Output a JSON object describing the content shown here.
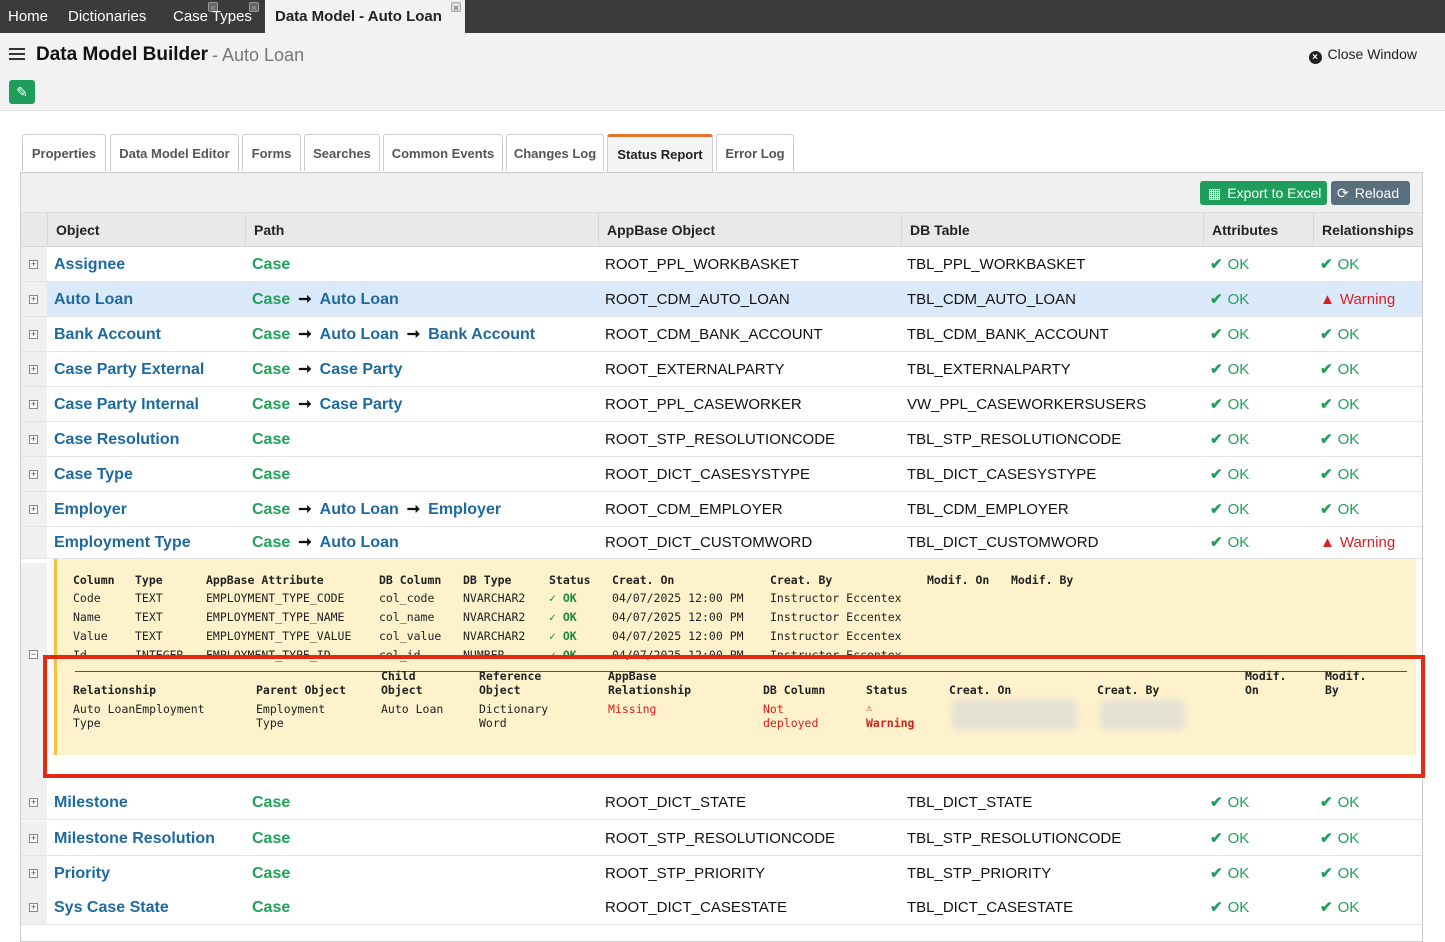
{
  "top_tabs": [
    {
      "label": "Home"
    },
    {
      "label": "Dictionaries",
      "close": "×"
    },
    {
      "label": "Case Types",
      "close": "×"
    },
    {
      "label": "Data Model - Auto Loan",
      "close": "×"
    }
  ],
  "header": {
    "title": "Data Model Builder",
    "subtitle": "- Auto Loan",
    "close_label": "Close Window"
  },
  "sub_tabs": [
    {
      "label": "Properties"
    },
    {
      "label": "Data Model Editor"
    },
    {
      "label": "Forms"
    },
    {
      "label": "Searches"
    },
    {
      "label": "Common Events"
    },
    {
      "label": "Changes Log"
    },
    {
      "label": "Status Report"
    },
    {
      "label": "Error Log"
    }
  ],
  "toolbar": {
    "export_label": "Export to Excel",
    "reload_label": "Reload"
  },
  "columns": {
    "object": "Object",
    "path": "Path",
    "appbase": "AppBase Object",
    "db": "DB Table",
    "attributes": "Attributes",
    "relationships": "Relationships"
  },
  "rows": [
    {
      "object": "Assignee",
      "path": [
        "Case"
      ],
      "appbase": "ROOT_PPL_WORKBASKET",
      "db": "TBL_PPL_WORKBASKET",
      "attributes": "OK",
      "relationships": "OK"
    },
    {
      "object": "Auto Loan",
      "path": [
        "Case",
        "Auto Loan"
      ],
      "appbase": "ROOT_CDM_AUTO_LOAN",
      "db": "TBL_CDM_AUTO_LOAN",
      "attributes": "OK",
      "relationships": "Warning"
    },
    {
      "object": "Bank Account",
      "path": [
        "Case",
        "Auto Loan",
        "Bank Account"
      ],
      "appbase": "ROOT_CDM_BANK_ACCOUNT",
      "db": "TBL_CDM_BANK_ACCOUNT",
      "attributes": "OK",
      "relationships": "OK"
    },
    {
      "object": "Case Party External",
      "path": [
        "Case",
        "Case Party"
      ],
      "appbase": "ROOT_EXTERNALPARTY",
      "db": "TBL_EXTERNALPARTY",
      "attributes": "OK",
      "relationships": "OK"
    },
    {
      "object": "Case Party Internal",
      "path": [
        "Case",
        "Case Party"
      ],
      "appbase": "ROOT_PPL_CASEWORKER",
      "db": "VW_PPL_CASEWORKERSUSERS",
      "attributes": "OK",
      "relationships": "OK"
    },
    {
      "object": "Case Resolution",
      "path": [
        "Case"
      ],
      "appbase": "ROOT_STP_RESOLUTIONCODE",
      "db": "TBL_STP_RESOLUTIONCODE",
      "attributes": "OK",
      "relationships": "OK"
    },
    {
      "object": "Case Type",
      "path": [
        "Case"
      ],
      "appbase": "ROOT_DICT_CASESYSTYPE",
      "db": "TBL_DICT_CASESYSTYPE",
      "attributes": "OK",
      "relationships": "OK"
    },
    {
      "object": "Employer",
      "path": [
        "Case",
        "Auto Loan",
        "Employer"
      ],
      "appbase": "ROOT_CDM_EMPLOYER",
      "db": "TBL_CDM_EMPLOYER",
      "attributes": "OK",
      "relationships": "OK"
    },
    {
      "object": "Employment Type",
      "path": [
        "Case",
        "Auto Loan"
      ],
      "appbase": "ROOT_DICT_CUSTOMWORD",
      "db": "TBL_DICT_CUSTOMWORD",
      "attributes": "OK",
      "relationships": "Warning"
    },
    {
      "object": "Milestone",
      "path": [
        "Case"
      ],
      "appbase": "ROOT_DICT_STATE",
      "db": "TBL_DICT_STATE",
      "attributes": "OK",
      "relationships": "OK"
    },
    {
      "object": "Milestone Resolution",
      "path": [
        "Case"
      ],
      "appbase": "ROOT_STP_RESOLUTIONCODE",
      "db": "TBL_STP_RESOLUTIONCODE",
      "attributes": "OK",
      "relationships": "OK"
    },
    {
      "object": "Priority",
      "path": [
        "Case"
      ],
      "appbase": "ROOT_STP_PRIORITY",
      "db": "TBL_STP_PRIORITY",
      "attributes": "OK",
      "relationships": "OK"
    },
    {
      "object": "Sys Case State",
      "path": [
        "Case"
      ],
      "appbase": "ROOT_DICT_CASESTATE",
      "db": "TBL_DICT_CASESTATE",
      "attributes": "OK",
      "relationships": "OK"
    }
  ],
  "attr_detail": {
    "headers": [
      "Column",
      "Type",
      "AppBase Attribute",
      "DB Column",
      "DB Type",
      "Status",
      "Creat. On",
      "Creat. By",
      "Modif. On",
      "Modif. By"
    ],
    "rows": [
      [
        "Code",
        "TEXT",
        "EMPLOYMENT_TYPE_CODE",
        "col_code",
        "NVARCHAR2",
        "✓ OK",
        "04/07/2025 12:00 PM",
        "Instructor Eccentex"
      ],
      [
        "Name",
        "TEXT",
        "EMPLOYMENT_TYPE_NAME",
        "col_name",
        "NVARCHAR2",
        "✓ OK",
        "04/07/2025 12:00 PM",
        "Instructor Eccentex"
      ],
      [
        "Value",
        "TEXT",
        "EMPLOYMENT_TYPE_VALUE",
        "col_value",
        "NVARCHAR2",
        "✓ OK",
        "04/07/2025 12:00 PM",
        "Instructor Eccentex"
      ],
      [
        "Id",
        "INTEGER",
        "EMPLOYMENT_TYPE_ID",
        "col_id",
        "NUMBER",
        "✓ OK",
        "04/07/2025 12:00 PM",
        "Instructor Eccentex"
      ]
    ]
  },
  "rel_detail": {
    "headers": {
      "relationship": "Relationship",
      "parent": "Parent Object",
      "child": "Child\nObject",
      "reference": "Reference\nObject",
      "appbase": "AppBase\nRelationship",
      "db_column": "DB Column",
      "status": "Status",
      "creat_on": "Creat. On",
      "creat_by": "Creat. By",
      "modif_on": "Modif.\nOn",
      "modif_by": "Modif.\nBy"
    },
    "row": {
      "relationship": "Auto LoanEmployment\nType",
      "parent": "Employment\nType",
      "child": "Auto Loan",
      "reference": "Dictionary\nWord",
      "appbase": "Missing",
      "db_column": "Not\ndeployed",
      "status_icon": "⚠",
      "status": "Warning"
    }
  },
  "colors": {
    "ok": "#22a05a",
    "warning": "#d52020",
    "link": "#1e6a9e",
    "accent": "#e8742c",
    "highlight_box": "#e52a14"
  }
}
